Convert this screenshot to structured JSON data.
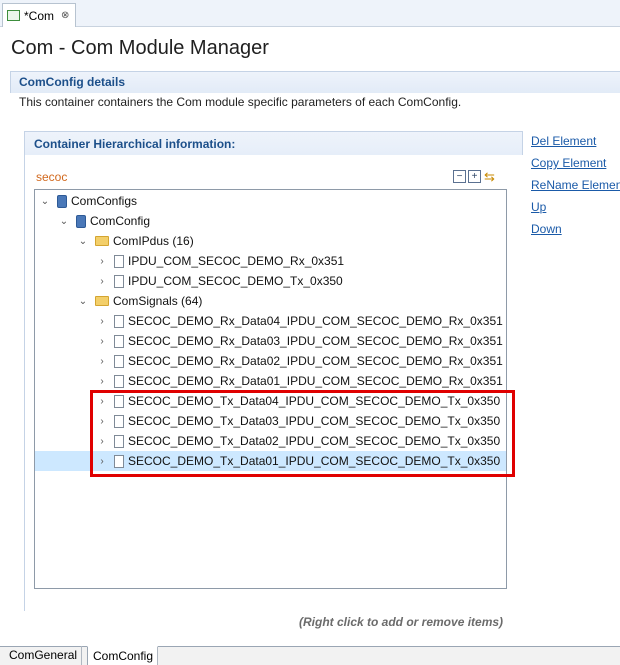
{
  "editor_tab": {
    "label": "*Com",
    "close": "⊗"
  },
  "page_title": "Com - Com Module Manager",
  "section": {
    "title": "ComConfig details",
    "description": "This container containers the Com module specific parameters of each ComConfig."
  },
  "group": {
    "title": "Container Hierarchical information:",
    "tree_label": "secoc"
  },
  "tree": [
    {
      "label": "ComConfigs",
      "icon": "db-icon",
      "depth": 0,
      "arrow": "expanded"
    },
    {
      "label": "ComConfig",
      "icon": "db-icon",
      "depth": 1,
      "arrow": "expanded"
    },
    {
      "label": "ComIPdus (16)",
      "icon": "folder-icon",
      "depth": 2,
      "arrow": "expanded"
    },
    {
      "label": "IPDU_COM_SECOC_DEMO_Rx_0x351",
      "icon": "file-icon",
      "depth": 3,
      "arrow": "collapsed"
    },
    {
      "label": "IPDU_COM_SECOC_DEMO_Tx_0x350",
      "icon": "file-icon",
      "depth": 3,
      "arrow": "collapsed"
    },
    {
      "label": "ComSignals (64)",
      "icon": "folder-icon",
      "depth": 2,
      "arrow": "expanded"
    },
    {
      "label": "SECOC_DEMO_Rx_Data04_IPDU_COM_SECOC_DEMO_Rx_0x351",
      "icon": "file-icon",
      "depth": 3,
      "arrow": "collapsed"
    },
    {
      "label": "SECOC_DEMO_Rx_Data03_IPDU_COM_SECOC_DEMO_Rx_0x351",
      "icon": "file-icon",
      "depth": 3,
      "arrow": "collapsed"
    },
    {
      "label": "SECOC_DEMO_Rx_Data02_IPDU_COM_SECOC_DEMO_Rx_0x351",
      "icon": "file-icon",
      "depth": 3,
      "arrow": "collapsed"
    },
    {
      "label": "SECOC_DEMO_Rx_Data01_IPDU_COM_SECOC_DEMO_Rx_0x351",
      "icon": "file-icon",
      "depth": 3,
      "arrow": "collapsed"
    },
    {
      "label": "SECOC_DEMO_Tx_Data04_IPDU_COM_SECOC_DEMO_Tx_0x350",
      "icon": "file-icon",
      "depth": 3,
      "arrow": "collapsed"
    },
    {
      "label": "SECOC_DEMO_Tx_Data03_IPDU_COM_SECOC_DEMO_Tx_0x350",
      "icon": "file-icon",
      "depth": 3,
      "arrow": "collapsed"
    },
    {
      "label": "SECOC_DEMO_Tx_Data02_IPDU_COM_SECOC_DEMO_Tx_0x350",
      "icon": "file-icon",
      "depth": 3,
      "arrow": "collapsed"
    },
    {
      "label": "SECOC_DEMO_Tx_Data01_IPDU_COM_SECOC_DEMO_Tx_0x350",
      "icon": "file-icon",
      "depth": 3,
      "arrow": "collapsed",
      "selected": true
    }
  ],
  "actions": [
    "Del Element",
    "Copy Element",
    "ReName Element",
    "Up",
    "Down"
  ],
  "hint": "(Right click to add or remove items)",
  "page_tabs": [
    "ComGeneral",
    "ComConfig"
  ],
  "colors": {
    "highlight": "#e00000",
    "selection": "#cde8ff",
    "link": "#1a5aa8"
  }
}
